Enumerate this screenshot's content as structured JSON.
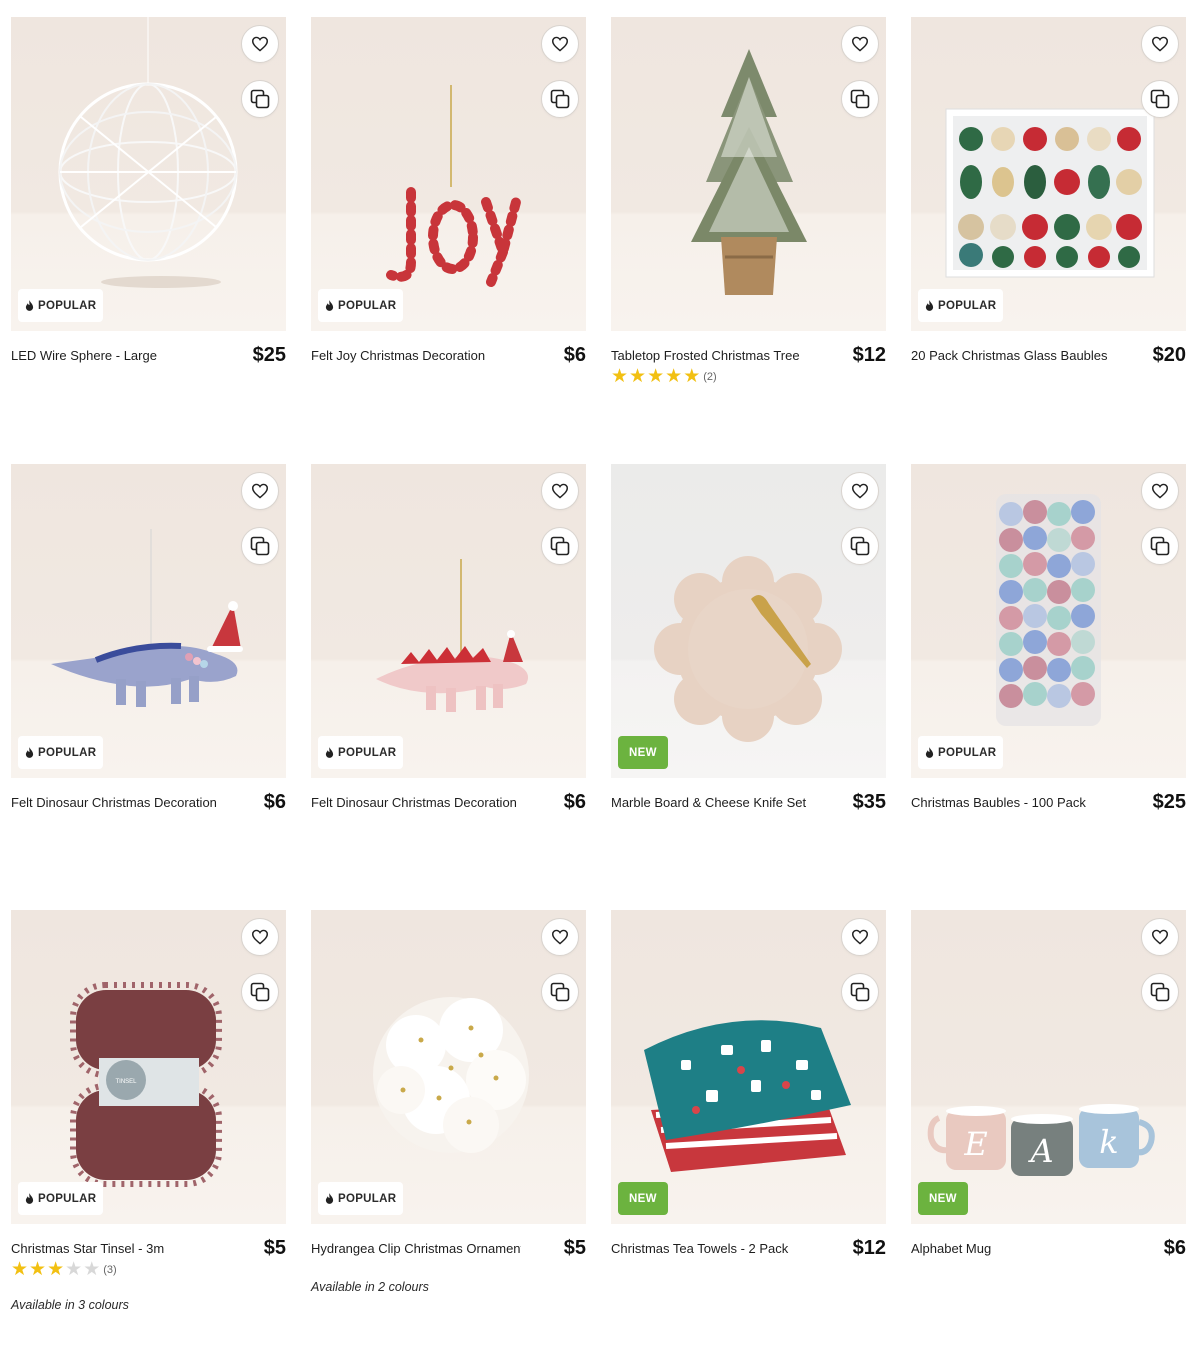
{
  "products": [
    {
      "title": "LED Wire Sphere - Large",
      "price": "$25",
      "badge": "POPULAR"
    },
    {
      "title": "Felt Joy Christmas Decoration",
      "price": "$6",
      "badge": "POPULAR"
    },
    {
      "title": "Tabletop Frosted Christmas Tree",
      "price": "$12",
      "badge": "",
      "rating": 5,
      "review_count": "(2)"
    },
    {
      "title": "20 Pack Christmas Glass Baubles",
      "price": "$20",
      "badge": "POPULAR"
    },
    {
      "title": "Felt Dinosaur Christmas Decoration",
      "price": "$6",
      "badge": "POPULAR"
    },
    {
      "title": "Felt Dinosaur Christmas Decoration",
      "price": "$6",
      "badge": "POPULAR"
    },
    {
      "title": "Marble Board & Cheese Knife Set",
      "price": "$35",
      "badge": "NEW"
    },
    {
      "title": "Christmas Baubles - 100 Pack",
      "price": "$25",
      "badge": "POPULAR"
    },
    {
      "title": "Christmas Star Tinsel - 3m",
      "price": "$5",
      "badge": "POPULAR",
      "rating": 3,
      "review_count": "(3)",
      "colours": "Available in 3 colours"
    },
    {
      "title": "Hydrangea Clip Christmas Ornament",
      "price": "$5",
      "badge": "POPULAR",
      "colours": "Available in 2 colours"
    },
    {
      "title": "Christmas Tea Towels - 2 Pack",
      "price": "$12",
      "badge": "NEW"
    },
    {
      "title": "Alphabet Mug",
      "price": "$6",
      "badge": "NEW"
    }
  ],
  "icons": {
    "favourite": "heart-icon",
    "compare": "compare-icon",
    "popular": "flame-icon",
    "star": "star-icon"
  },
  "colors": {
    "new_badge": "#6cb33f",
    "star": "#f2c012",
    "popular_badge_bg": "#ffffff"
  }
}
